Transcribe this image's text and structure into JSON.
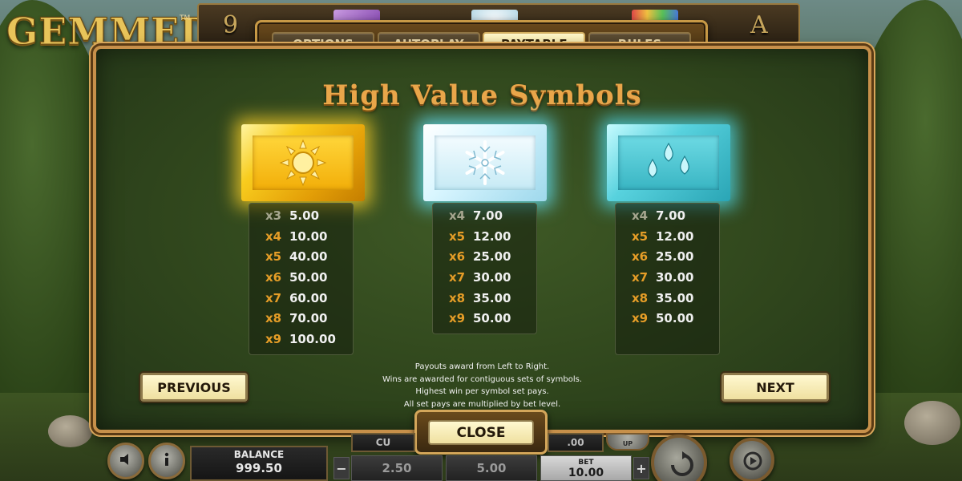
{
  "game": {
    "logo": "GEMMED!",
    "tm": "TM"
  },
  "reel_preview": {
    "chars": [
      "9",
      "A"
    ]
  },
  "tabs": [
    {
      "label": "OPTIONS",
      "active": false
    },
    {
      "label": "AUTOPLAY",
      "active": false
    },
    {
      "label": "PAYTABLE",
      "active": true
    },
    {
      "label": "RULES",
      "active": false
    }
  ],
  "paytable": {
    "title": "High Value Symbols",
    "symbols": [
      {
        "icon": "sun-icon",
        "color": "#f5c518",
        "payouts": [
          {
            "mult": "x3",
            "value": "5.00"
          },
          {
            "mult": "x4",
            "value": "10.00"
          },
          {
            "mult": "x5",
            "value": "40.00"
          },
          {
            "mult": "x6",
            "value": "50.00"
          },
          {
            "mult": "x7",
            "value": "60.00"
          },
          {
            "mult": "x8",
            "value": "70.00"
          },
          {
            "mult": "x9",
            "value": "100.00"
          }
        ]
      },
      {
        "icon": "snowflake-icon",
        "color": "#d9f6ff",
        "payouts": [
          {
            "mult": "x4",
            "value": "7.00"
          },
          {
            "mult": "x5",
            "value": "12.00"
          },
          {
            "mult": "x6",
            "value": "25.00"
          },
          {
            "mult": "x7",
            "value": "30.00"
          },
          {
            "mult": "x8",
            "value": "35.00"
          },
          {
            "mult": "x9",
            "value": "50.00"
          }
        ]
      },
      {
        "icon": "water-drops-icon",
        "color": "#4cc9d6",
        "payouts": [
          {
            "mult": "x4",
            "value": "7.00"
          },
          {
            "mult": "x5",
            "value": "12.00"
          },
          {
            "mult": "x6",
            "value": "25.00"
          },
          {
            "mult": "x7",
            "value": "30.00"
          },
          {
            "mult": "x8",
            "value": "35.00"
          },
          {
            "mult": "x9",
            "value": "50.00"
          }
        ]
      }
    ],
    "info_lines": [
      "Payouts award from Left to Right.",
      "Wins are awarded for contiguous sets of symbols.",
      "Highest win per symbol set pays.",
      "All set pays are multiplied by bet level."
    ],
    "previous_label": "PREVIOUS",
    "next_label": "NEXT",
    "close_label": "CLOSE"
  },
  "hud": {
    "balance_label": "BALANCE",
    "balance_value": "999.50",
    "partial_label_left": "CU",
    "partial_label_right": ".00",
    "bet_options": [
      "2.50",
      "5.00"
    ],
    "bet_label": "BET",
    "bet_value": "10.00",
    "minus_label": "−",
    "plus_label": "+",
    "up_label": "UP"
  }
}
